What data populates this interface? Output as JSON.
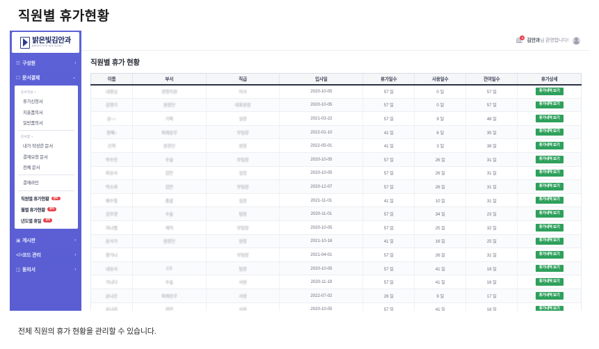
{
  "page": {
    "title": "직원별 휴가현황",
    "caption": "전체 직원의 휴가 현황을 관리할 수 있습니다."
  },
  "sidebar": {
    "logo": {
      "name": "밝은빛김안과",
      "sub": "BRIGHT EYE KIM CLINIC",
      "icon": "clinic-logo-icon"
    },
    "nav": [
      {
        "icon": "users-icon",
        "label": "구성원",
        "arrow": "›",
        "expanded": false
      },
      {
        "icon": "document-icon",
        "label": "문서결재",
        "arrow": "⌄",
        "expanded": true
      }
    ],
    "submenu": {
      "group1_label": "문서작성 +",
      "group1_items": [
        "휴가신청서",
        "지출품의서",
        "일반품의서"
      ],
      "group2_label": "문서함 +",
      "group2_items": [
        "내가 작성한 문서",
        "결재요청 문서",
        "전체 문서"
      ],
      "group3_items": [
        "결재라인"
      ],
      "admin_items": [
        {
          "label": "직원별 휴가현황",
          "badge": "관리"
        },
        {
          "label": "월별 휴가현황",
          "badge": "관리"
        },
        {
          "label": "년도별 휴일",
          "badge": "관리"
        }
      ]
    },
    "nav_bottom": [
      {
        "icon": "board-icon",
        "label": "게시판",
        "arrow": "›"
      },
      {
        "icon": "code-icon",
        "label": "코드 관리",
        "arrow": "›"
      },
      {
        "icon": "consent-icon",
        "label": "동의서",
        "arrow": "›"
      }
    ]
  },
  "topbar": {
    "bell_icon": "bell-icon",
    "bell_count": "1",
    "user_name": "김안과",
    "welcome_suffix": "님 환영합니다!",
    "avatar_icon": "user-avatar-icon"
  },
  "panel": {
    "title": "직원별 휴가 현황",
    "columns": [
      "이름",
      "부서",
      "직급",
      "입사일",
      "휴가일수",
      "사용일수",
      "잔여일수",
      "휴가상세"
    ],
    "detail_button_label": "휴가내역 보기",
    "rows": [
      {
        "name": "내용님",
        "dept": "경영지원",
        "rank": "이사",
        "hired": "2020-10-05",
        "total": "57 일",
        "used": "0 일",
        "remain": "57 일"
      },
      {
        "name": "김영기",
        "dept": "원장단",
        "rank": "대표원장",
        "hired": "2020-10-05",
        "total": "57 일",
        "used": "0 일",
        "remain": "57 일"
      },
      {
        "name": "윤○○",
        "dept": "기획",
        "rank": "실장",
        "hired": "2021-03-22",
        "total": "57 일",
        "used": "9 일",
        "remain": "48 일"
      },
      {
        "name": "정혜○",
        "dept": "외래응무",
        "rank": "부팀장",
        "hired": "2022-01-10",
        "total": "41 일",
        "used": "6 일",
        "remain": "35 일"
      },
      {
        "name": "신혁",
        "dept": "원장단",
        "rank": "원장",
        "hired": "2022-05-01",
        "total": "41 일",
        "used": "3 일",
        "remain": "38 일"
      },
      {
        "name": "박수진",
        "dept": "수술",
        "rank": "부팀장",
        "hired": "2020-10-05",
        "total": "57 일",
        "used": "26 일",
        "remain": "31 일"
      },
      {
        "name": "최유사",
        "dept": "검안",
        "rank": "실장",
        "hired": "2020-10-05",
        "total": "57 일",
        "used": "26 일",
        "remain": "31 일"
      },
      {
        "name": "박소희",
        "dept": "검안",
        "rank": "부팀장",
        "hired": "2020-12-07",
        "total": "57 일",
        "used": "26 일",
        "remain": "31 일"
      },
      {
        "name": "배수철",
        "dept": "총괄",
        "rank": "실장",
        "hired": "2021-11-01",
        "total": "41 일",
        "used": "10 일",
        "remain": "31 일"
      },
      {
        "name": "김부경",
        "dept": "수술",
        "rank": "팀장",
        "hired": "2020-11-01",
        "total": "57 일",
        "used": "34 일",
        "remain": "23 일"
      },
      {
        "name": "하나별",
        "dept": "케어",
        "rank": "부팀장",
        "hired": "2020-10-05",
        "total": "57 일",
        "used": "25 일",
        "remain": "32 일"
      },
      {
        "name": "윤사가",
        "dept": "원장단",
        "rank": "원장",
        "hired": "2021-10-18",
        "total": "41 일",
        "used": "16 일",
        "remain": "25 일"
      },
      {
        "name": "열가나",
        "dept": "",
        "rank": "부팀장",
        "hired": "2021-04-01",
        "total": "57 일",
        "used": "26 일",
        "remain": "31 일"
      },
      {
        "name": "내유사",
        "dept": "CS",
        "rank": "팀장",
        "hired": "2020-10-05",
        "total": "57 일",
        "used": "41 일",
        "remain": "16 일"
      },
      {
        "name": "가나다",
        "dept": "수술",
        "rank": "사원",
        "hired": "2020-11-19",
        "total": "57 일",
        "used": "41 일",
        "remain": "16 일"
      },
      {
        "name": "윤나은",
        "dept": "외래응무",
        "rank": "사원",
        "hired": "2022-07-02",
        "total": "26 일",
        "used": "9 일",
        "remain": "17 일"
      },
      {
        "name": "윤나라",
        "dept": "검안",
        "rank": "사원",
        "hired": "2020-10-05",
        "total": "57 일",
        "used": "41 일",
        "remain": "16 일"
      }
    ]
  },
  "colors": {
    "sidebar": "#5b5fd4",
    "badge_admin": "#e8404a",
    "detail_button": "#2ea05c",
    "header_underline": "#2b3040"
  }
}
